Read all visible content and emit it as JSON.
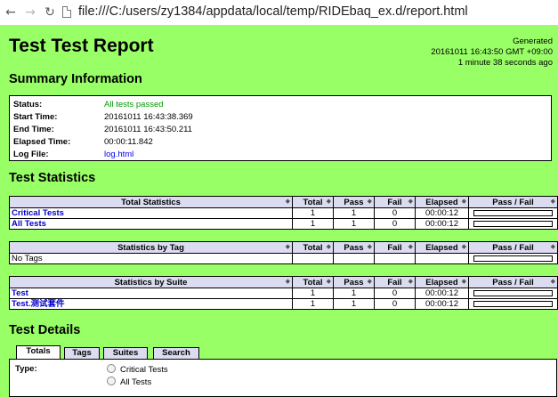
{
  "browser": {
    "url": "file:///C:/users/zy1384/appdata/local/temp/RIDEbaq_ex.d/report.html"
  },
  "header": {
    "title": "Test Test Report",
    "generated_label": "Generated",
    "generated_time": "20161011 16:43:50 GMT +09:00",
    "generated_ago": "1 minute 38 seconds ago"
  },
  "summary": {
    "heading": "Summary Information",
    "rows": [
      {
        "label": "Status:",
        "value": "All tests passed"
      },
      {
        "label": "Start Time:",
        "value": "20161011 16:43:38.369"
      },
      {
        "label": "End Time:",
        "value": "20161011 16:43:50.211"
      },
      {
        "label": "Elapsed Time:",
        "value": "00:00:11.842"
      },
      {
        "label": "Log File:",
        "value": "log.html"
      }
    ]
  },
  "statistics": {
    "heading": "Test Statistics",
    "columns": {
      "total": "Total",
      "pass": "Pass",
      "fail": "Fail",
      "elapsed": "Elapsed",
      "passfail": "Pass / Fail"
    },
    "total_table": {
      "title": "Total Statistics",
      "rows": [
        {
          "name": "Critical Tests",
          "total": "1",
          "pass": "1",
          "fail": "0",
          "elapsed": "00:00:12",
          "pass_ratio": 1.0
        },
        {
          "name": "All Tests",
          "total": "1",
          "pass": "1",
          "fail": "0",
          "elapsed": "00:00:12",
          "pass_ratio": 1.0
        }
      ]
    },
    "tag_table": {
      "title": "Statistics by Tag",
      "empty_text": "No Tags"
    },
    "suite_table": {
      "title": "Statistics by Suite",
      "rows": [
        {
          "name": "Test",
          "total": "1",
          "pass": "1",
          "fail": "0",
          "elapsed": "00:00:12",
          "pass_ratio": 1.0
        },
        {
          "name": "Test.测试套件",
          "total": "1",
          "pass": "1",
          "fail": "0",
          "elapsed": "00:00:12",
          "pass_ratio": 1.0
        }
      ]
    }
  },
  "details": {
    "heading": "Test Details",
    "tabs": [
      "Totals",
      "Tags",
      "Suites",
      "Search"
    ],
    "active_tab": "Totals",
    "type_label": "Type:",
    "options": [
      "Critical Tests",
      "All Tests"
    ]
  },
  "colors": {
    "background": "#99FF66",
    "table_header": "#DCDCF0",
    "pass_bar": "#00CC00",
    "pass_text": "#009900",
    "link": "#0000EE"
  }
}
